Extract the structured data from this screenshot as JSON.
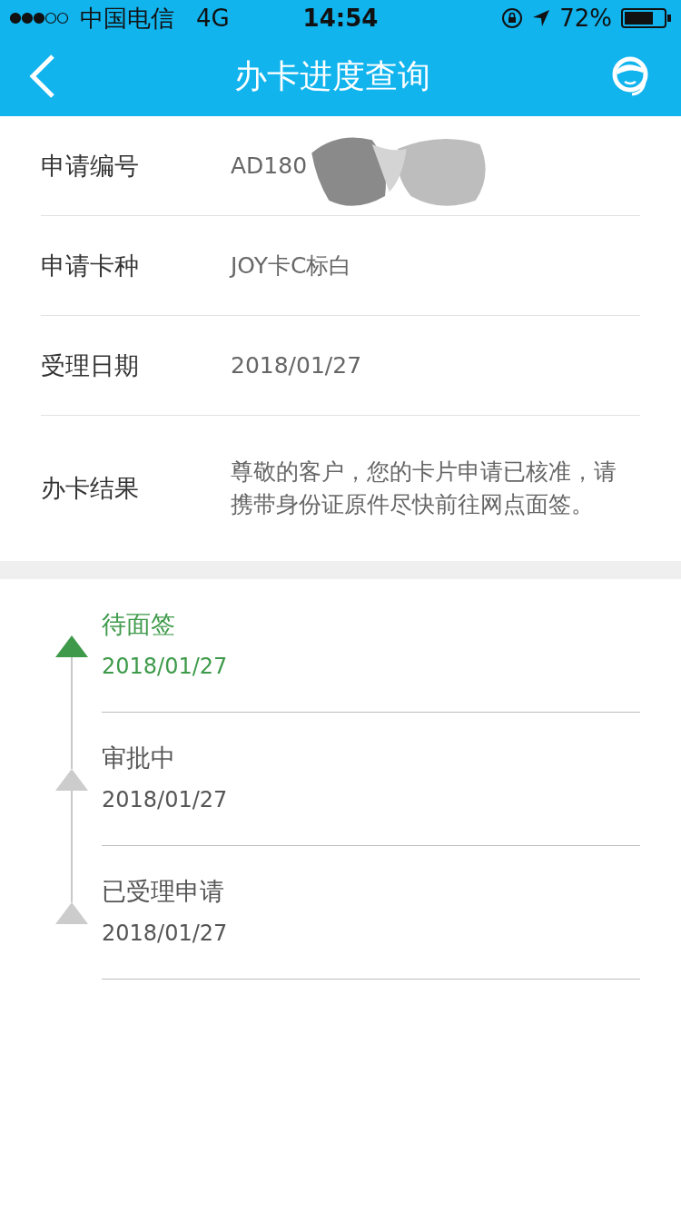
{
  "status_bar": {
    "carrier": "中国电信",
    "network": "4G",
    "time": "14:54",
    "battery": "72%"
  },
  "nav": {
    "title": "办卡进度查询"
  },
  "info_rows": [
    {
      "label": "申请编号",
      "value": "AD180",
      "redacted": true
    },
    {
      "label": "申请卡种",
      "value": "JOY卡C标白",
      "redacted": false
    },
    {
      "label": "受理日期",
      "value": "2018/01/27",
      "redacted": false
    },
    {
      "label": "办卡结果",
      "value": "尊敬的客户，您的卡片申请已核准，请携带身份证原件尽快前往网点面签。",
      "redacted": false
    }
  ],
  "steps": [
    {
      "label": "待面签",
      "date": "2018/01/27",
      "selected": true
    },
    {
      "label": "审批中",
      "date": "2018/01/27",
      "selected": false
    },
    {
      "label": "已受理申请",
      "date": "2018/01/27",
      "selected": false
    }
  ]
}
